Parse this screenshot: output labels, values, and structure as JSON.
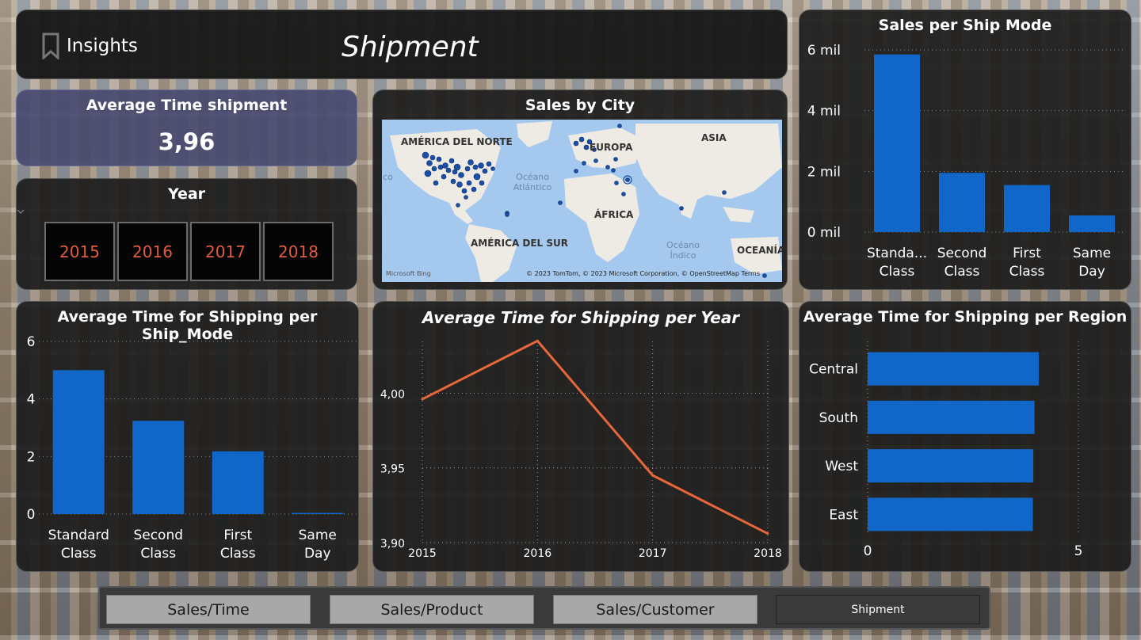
{
  "header": {
    "insights_label": "Insights",
    "page_title": "Shipment"
  },
  "kpi": {
    "title": "Average Time shipment",
    "value": "3,96"
  },
  "year_slicer": {
    "title": "Year",
    "options": [
      "2015",
      "2016",
      "2017",
      "2018"
    ]
  },
  "map": {
    "title": "Sales by City",
    "regions": [
      "AMÉRICA DEL NORTE",
      "EUROPA",
      "ASIA",
      "ÁFRICA",
      "AMÉRICA DEL SUR",
      "OCEANÍA"
    ],
    "oceans": [
      "Océano Atlántico",
      "Océano Índico"
    ],
    "partial_label": "co",
    "credit": "© 2023 TomTom, © 2023 Microsoft Corporation, © OpenStreetMap  Terms",
    "logo": "Microsoft Bing"
  },
  "chart_data": [
    {
      "type": "bar",
      "title": "Sales per Ship Mode",
      "categories": [
        "Standa... Class",
        "Second Class",
        "First Class",
        "Same Day"
      ],
      "values": [
        5.85,
        1.95,
        1.55,
        0.55
      ],
      "ylim": [
        0,
        6
      ],
      "ytick_labels": [
        "0 mil",
        "2 mil",
        "4 mil",
        "6 mil"
      ],
      "grid": true
    },
    {
      "type": "bar",
      "title": "Average Time for Shipping per Ship_Mode",
      "categories": [
        "Standard Class",
        "Second Class",
        "First Class",
        "Same Day"
      ],
      "values": [
        5.0,
        3.24,
        2.18,
        0.04
      ],
      "ylim": [
        0,
        6
      ],
      "ytick_labels": [
        "0",
        "2",
        "4",
        "6"
      ],
      "grid": true
    },
    {
      "type": "line",
      "title": "Average Time for Shipping per Year",
      "x": [
        "2015",
        "2016",
        "2017",
        "2018"
      ],
      "values": [
        3.996,
        4.035,
        3.945,
        3.906
      ],
      "ylim": [
        3.9,
        4.04
      ],
      "ytick_labels": [
        "3,90",
        "3,95",
        "4,00"
      ],
      "color": "#e8673a",
      "grid": true
    },
    {
      "type": "bar",
      "orientation": "horizontal",
      "title": "Average Time for Shipping per Region",
      "categories": [
        "Central",
        "South",
        "West",
        "East"
      ],
      "values": [
        4.06,
        3.96,
        3.93,
        3.92
      ],
      "xlim": [
        0,
        5
      ],
      "xtick_labels": [
        "0",
        "5"
      ],
      "grid": true
    }
  ],
  "nav": {
    "buttons": [
      "Sales/Time",
      "Sales/Product",
      "Sales/Customer",
      "Shipment"
    ],
    "active": "Shipment"
  },
  "colors": {
    "bar": "#1167c7",
    "line": "#e8673a",
    "year_text": "#e35b3e"
  }
}
